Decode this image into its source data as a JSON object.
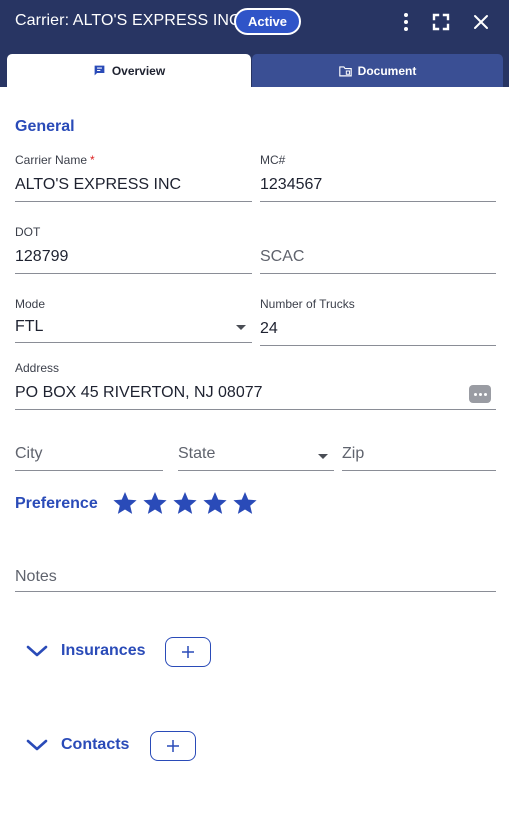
{
  "header": {
    "title": "Carrier: ALTO'S EXPRESS INC",
    "status": "Active",
    "icons": [
      "more-vert-icon",
      "fullscreen-icon",
      "close-icon"
    ]
  },
  "tabs": [
    {
      "label": "Overview",
      "icon": "comment-icon",
      "active": true
    },
    {
      "label": "Document",
      "icon": "folder-icon",
      "active": false
    }
  ],
  "general": {
    "title": "General",
    "carrier_name": {
      "label": "Carrier Name",
      "required_mark": "*",
      "value": "ALTO'S EXPRESS INC"
    },
    "mc": {
      "label": "MC#",
      "value": "1234567"
    },
    "dot": {
      "label": "DOT",
      "value": "128799"
    },
    "scac": {
      "placeholder": "SCAC"
    },
    "mode": {
      "label": "Mode",
      "value": "FTL"
    },
    "trucks": {
      "label": "Number of Trucks",
      "value": "24"
    },
    "address": {
      "label": "Address",
      "value": "PO BOX 45 RIVERTON, NJ  08077"
    },
    "city": {
      "placeholder": "City"
    },
    "state": {
      "placeholder": "State"
    },
    "zip": {
      "placeholder": "Zip"
    }
  },
  "preference": {
    "label": "Preference",
    "rating": 5,
    "max": 5
  },
  "notes": {
    "placeholder": "Notes"
  },
  "sections": [
    {
      "label": "Insurances"
    },
    {
      "label": "Contacts"
    }
  ],
  "colors": {
    "header": "#283563",
    "accent": "#2a4bb8",
    "badge": "#2f54c8",
    "tab_inactive": "#3a4f94"
  }
}
